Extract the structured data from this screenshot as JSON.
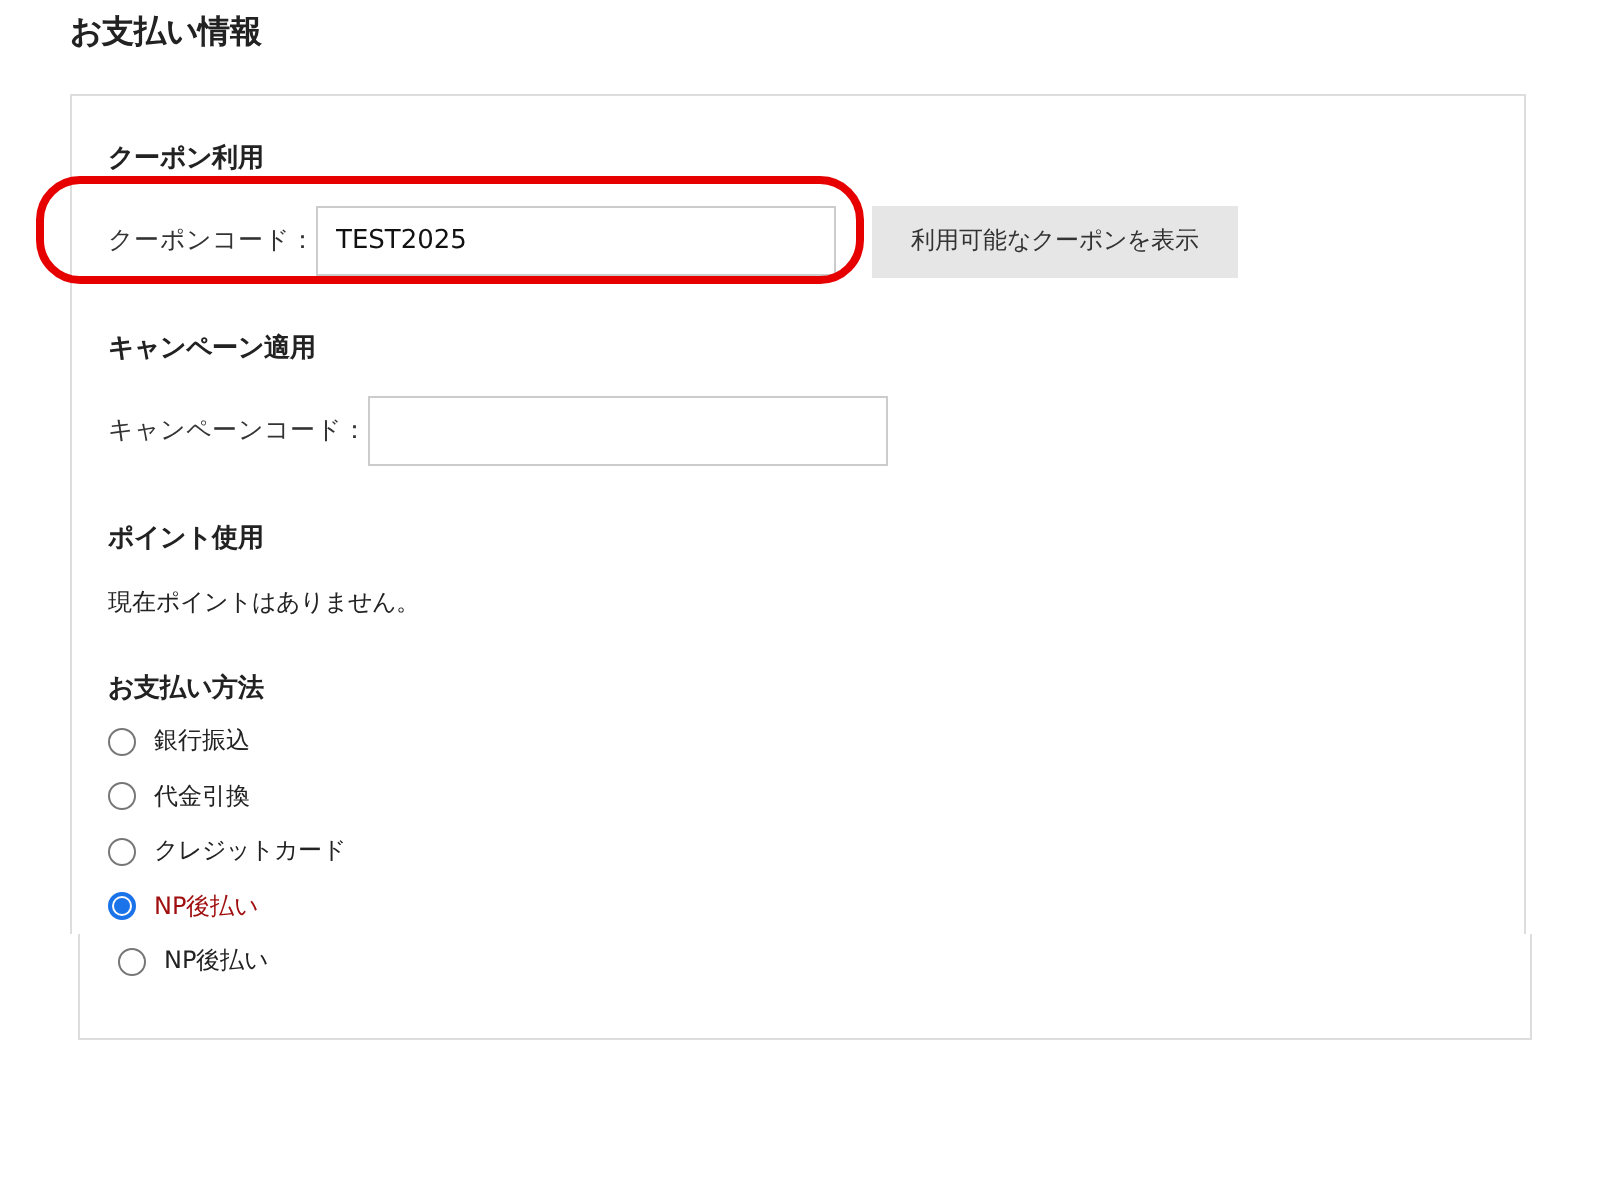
{
  "title": "お支払い情報",
  "coupon": {
    "heading": "クーポン利用",
    "label": "クーポンコード：",
    "value": "TEST2025",
    "button": "利用可能なクーポンを表示",
    "highlighted": true
  },
  "campaign": {
    "heading": "キャンペーン適用",
    "label": "キャンペーンコード："
  },
  "points": {
    "heading": "ポイント使用",
    "message": "現在ポイントはありません。"
  },
  "payment": {
    "heading": "お支払い方法",
    "options": [
      {
        "label": "銀行振込",
        "selected": false
      },
      {
        "label": "代金引換",
        "selected": false
      },
      {
        "label": "クレジットカード",
        "selected": false
      },
      {
        "label": "NP後払い",
        "selected": true
      }
    ]
  },
  "lower_panel": {
    "options": [
      {
        "label": "NP後払い",
        "selected": false
      }
    ]
  }
}
